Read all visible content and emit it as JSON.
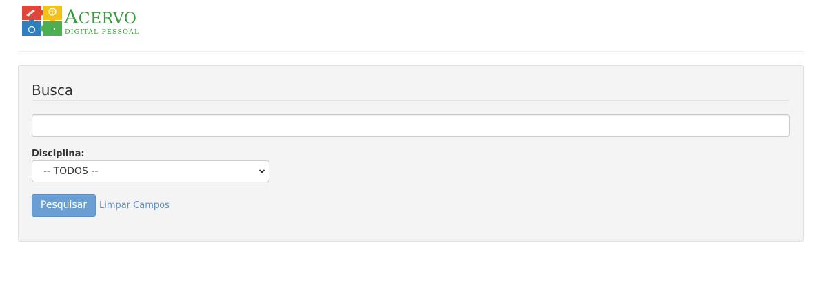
{
  "logo": {
    "title_first": "A",
    "title_rest": "CERVO",
    "subtitle": "DIGITAL PESSOAL",
    "colors": {
      "red": "#e0453a",
      "yellow": "#f2c11a",
      "blue": "#2d7fc1",
      "green": "#4caf50",
      "text": "#3a9a3e"
    }
  },
  "search_panel": {
    "title": "Busca",
    "search_input": {
      "value": "",
      "placeholder": ""
    },
    "discipline": {
      "label": "Disciplina:",
      "selected": "-- TODOS --"
    },
    "submit_label": "Pesquisar",
    "clear_label": "Limpar Campos"
  }
}
